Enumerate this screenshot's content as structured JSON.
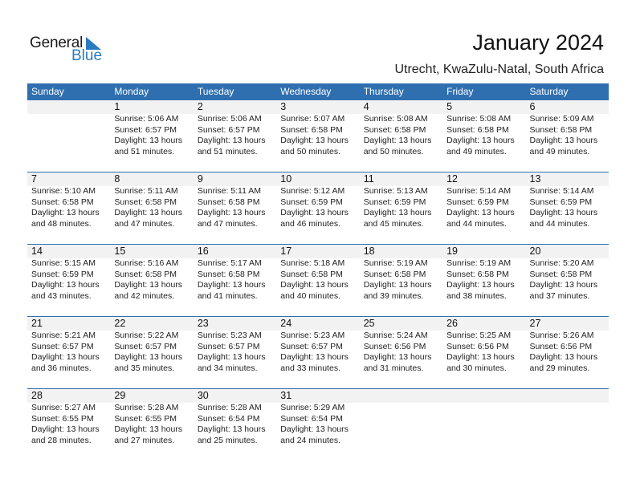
{
  "logo": {
    "line1": "General",
    "line2": "Blue"
  },
  "title": "January 2024",
  "subtitle": "Utrecht, KwaZulu-Natal, South Africa",
  "colors": {
    "accent": "#2f6fb0",
    "logo_blue": "#2a7bc0",
    "daynum_bg": "#f2f2f2"
  },
  "weekdays": [
    "Sunday",
    "Monday",
    "Tuesday",
    "Wednesday",
    "Thursday",
    "Friday",
    "Saturday"
  ],
  "weeks": [
    [
      null,
      {
        "day": "1",
        "sunrise": "Sunrise: 5:06 AM",
        "sunset": "Sunset: 6:57 PM",
        "daylight1": "Daylight: 13 hours",
        "daylight2": "and 51 minutes."
      },
      {
        "day": "2",
        "sunrise": "Sunrise: 5:06 AM",
        "sunset": "Sunset: 6:57 PM",
        "daylight1": "Daylight: 13 hours",
        "daylight2": "and 51 minutes."
      },
      {
        "day": "3",
        "sunrise": "Sunrise: 5:07 AM",
        "sunset": "Sunset: 6:58 PM",
        "daylight1": "Daylight: 13 hours",
        "daylight2": "and 50 minutes."
      },
      {
        "day": "4",
        "sunrise": "Sunrise: 5:08 AM",
        "sunset": "Sunset: 6:58 PM",
        "daylight1": "Daylight: 13 hours",
        "daylight2": "and 50 minutes."
      },
      {
        "day": "5",
        "sunrise": "Sunrise: 5:08 AM",
        "sunset": "Sunset: 6:58 PM",
        "daylight1": "Daylight: 13 hours",
        "daylight2": "and 49 minutes."
      },
      {
        "day": "6",
        "sunrise": "Sunrise: 5:09 AM",
        "sunset": "Sunset: 6:58 PM",
        "daylight1": "Daylight: 13 hours",
        "daylight2": "and 49 minutes."
      }
    ],
    [
      {
        "day": "7",
        "sunrise": "Sunrise: 5:10 AM",
        "sunset": "Sunset: 6:58 PM",
        "daylight1": "Daylight: 13 hours",
        "daylight2": "and 48 minutes."
      },
      {
        "day": "8",
        "sunrise": "Sunrise: 5:11 AM",
        "sunset": "Sunset: 6:58 PM",
        "daylight1": "Daylight: 13 hours",
        "daylight2": "and 47 minutes."
      },
      {
        "day": "9",
        "sunrise": "Sunrise: 5:11 AM",
        "sunset": "Sunset: 6:58 PM",
        "daylight1": "Daylight: 13 hours",
        "daylight2": "and 47 minutes."
      },
      {
        "day": "10",
        "sunrise": "Sunrise: 5:12 AM",
        "sunset": "Sunset: 6:59 PM",
        "daylight1": "Daylight: 13 hours",
        "daylight2": "and 46 minutes."
      },
      {
        "day": "11",
        "sunrise": "Sunrise: 5:13 AM",
        "sunset": "Sunset: 6:59 PM",
        "daylight1": "Daylight: 13 hours",
        "daylight2": "and 45 minutes."
      },
      {
        "day": "12",
        "sunrise": "Sunrise: 5:14 AM",
        "sunset": "Sunset: 6:59 PM",
        "daylight1": "Daylight: 13 hours",
        "daylight2": "and 44 minutes."
      },
      {
        "day": "13",
        "sunrise": "Sunrise: 5:14 AM",
        "sunset": "Sunset: 6:59 PM",
        "daylight1": "Daylight: 13 hours",
        "daylight2": "and 44 minutes."
      }
    ],
    [
      {
        "day": "14",
        "sunrise": "Sunrise: 5:15 AM",
        "sunset": "Sunset: 6:59 PM",
        "daylight1": "Daylight: 13 hours",
        "daylight2": "and 43 minutes."
      },
      {
        "day": "15",
        "sunrise": "Sunrise: 5:16 AM",
        "sunset": "Sunset: 6:58 PM",
        "daylight1": "Daylight: 13 hours",
        "daylight2": "and 42 minutes."
      },
      {
        "day": "16",
        "sunrise": "Sunrise: 5:17 AM",
        "sunset": "Sunset: 6:58 PM",
        "daylight1": "Daylight: 13 hours",
        "daylight2": "and 41 minutes."
      },
      {
        "day": "17",
        "sunrise": "Sunrise: 5:18 AM",
        "sunset": "Sunset: 6:58 PM",
        "daylight1": "Daylight: 13 hours",
        "daylight2": "and 40 minutes."
      },
      {
        "day": "18",
        "sunrise": "Sunrise: 5:19 AM",
        "sunset": "Sunset: 6:58 PM",
        "daylight1": "Daylight: 13 hours",
        "daylight2": "and 39 minutes."
      },
      {
        "day": "19",
        "sunrise": "Sunrise: 5:19 AM",
        "sunset": "Sunset: 6:58 PM",
        "daylight1": "Daylight: 13 hours",
        "daylight2": "and 38 minutes."
      },
      {
        "day": "20",
        "sunrise": "Sunrise: 5:20 AM",
        "sunset": "Sunset: 6:58 PM",
        "daylight1": "Daylight: 13 hours",
        "daylight2": "and 37 minutes."
      }
    ],
    [
      {
        "day": "21",
        "sunrise": "Sunrise: 5:21 AM",
        "sunset": "Sunset: 6:57 PM",
        "daylight1": "Daylight: 13 hours",
        "daylight2": "and 36 minutes."
      },
      {
        "day": "22",
        "sunrise": "Sunrise: 5:22 AM",
        "sunset": "Sunset: 6:57 PM",
        "daylight1": "Daylight: 13 hours",
        "daylight2": "and 35 minutes."
      },
      {
        "day": "23",
        "sunrise": "Sunrise: 5:23 AM",
        "sunset": "Sunset: 6:57 PM",
        "daylight1": "Daylight: 13 hours",
        "daylight2": "and 34 minutes."
      },
      {
        "day": "24",
        "sunrise": "Sunrise: 5:23 AM",
        "sunset": "Sunset: 6:57 PM",
        "daylight1": "Daylight: 13 hours",
        "daylight2": "and 33 minutes."
      },
      {
        "day": "25",
        "sunrise": "Sunrise: 5:24 AM",
        "sunset": "Sunset: 6:56 PM",
        "daylight1": "Daylight: 13 hours",
        "daylight2": "and 31 minutes."
      },
      {
        "day": "26",
        "sunrise": "Sunrise: 5:25 AM",
        "sunset": "Sunset: 6:56 PM",
        "daylight1": "Daylight: 13 hours",
        "daylight2": "and 30 minutes."
      },
      {
        "day": "27",
        "sunrise": "Sunrise: 5:26 AM",
        "sunset": "Sunset: 6:56 PM",
        "daylight1": "Daylight: 13 hours",
        "daylight2": "and 29 minutes."
      }
    ],
    [
      {
        "day": "28",
        "sunrise": "Sunrise: 5:27 AM",
        "sunset": "Sunset: 6:55 PM",
        "daylight1": "Daylight: 13 hours",
        "daylight2": "and 28 minutes."
      },
      {
        "day": "29",
        "sunrise": "Sunrise: 5:28 AM",
        "sunset": "Sunset: 6:55 PM",
        "daylight1": "Daylight: 13 hours",
        "daylight2": "and 27 minutes."
      },
      {
        "day": "30",
        "sunrise": "Sunrise: 5:28 AM",
        "sunset": "Sunset: 6:54 PM",
        "daylight1": "Daylight: 13 hours",
        "daylight2": "and 25 minutes."
      },
      {
        "day": "31",
        "sunrise": "Sunrise: 5:29 AM",
        "sunset": "Sunset: 6:54 PM",
        "daylight1": "Daylight: 13 hours",
        "daylight2": "and 24 minutes."
      },
      null,
      null,
      null
    ]
  ]
}
